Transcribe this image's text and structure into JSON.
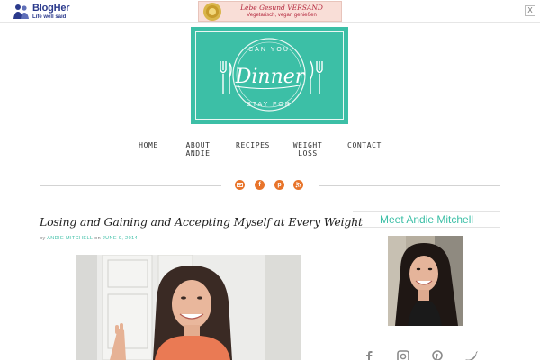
{
  "topbar": {
    "brand_name": "BlogHer",
    "brand_tagline": "Life well said",
    "ad_line1": "Lebe Gesund VERSAND",
    "ad_line2": "Vegetarisch, vegan genießen",
    "close_label": "X"
  },
  "logo": {
    "top_text": "CAN YOU",
    "main_text": "Dinner",
    "bottom_text": "STAY FOR"
  },
  "nav": {
    "items": [
      {
        "line1": "HOME",
        "line2": ""
      },
      {
        "line1": "ABOUT",
        "line2": "ANDIE"
      },
      {
        "line1": "RECIPES",
        "line2": ""
      },
      {
        "line1": "WEIGHT",
        "line2": "LOSS"
      },
      {
        "line1": "CONTACT",
        "line2": ""
      }
    ]
  },
  "social_top": [
    "email-icon",
    "facebook-icon",
    "pinterest-icon",
    "rss-icon"
  ],
  "post": {
    "title": "Losing and Gaining and Accepting Myself at Every Weight",
    "meta_by": "by",
    "meta_author": "ANDIE MITCHELL",
    "meta_on": "on",
    "meta_date": "JUNE 9, 2014"
  },
  "sidebar": {
    "heading": "Meet Andie Mitchell",
    "social": [
      "facebook-icon",
      "instagram-icon",
      "pinterest-icon",
      "twitter-icon"
    ]
  },
  "colors": {
    "accent": "#3cbfa6",
    "social_orange": "#e8742a",
    "brand_blue": "#2b3a8c"
  }
}
